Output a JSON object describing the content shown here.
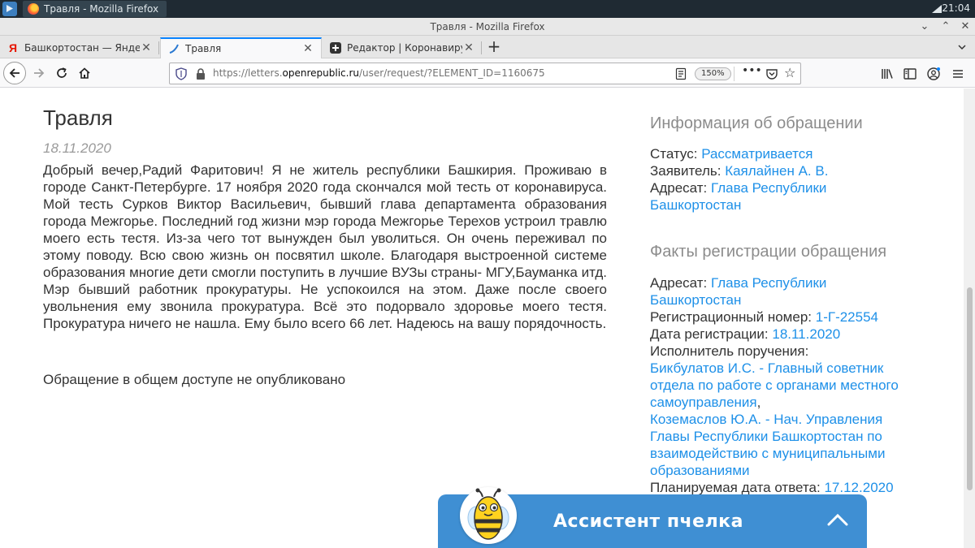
{
  "taskbar": {
    "task_label": "Травля - Mozilla Firefox",
    "clock": "21:04"
  },
  "window": {
    "title": "Травля - Mozilla Firefox"
  },
  "tabs": [
    {
      "label": "Башкортостан — Яндекс: на",
      "favicon": "yandex-icon"
    },
    {
      "label": "Травля",
      "favicon": "openrepublic-icon"
    },
    {
      "label": "Редактор | Коронавирус. Ча",
      "favicon": "editor-plus-icon"
    }
  ],
  "navbar": {
    "url_prefix": "https://letters.",
    "url_domain": "openrepublic.ru",
    "url_path": "/user/request/?ELEMENT_ID=1160675",
    "zoom": "150%"
  },
  "article": {
    "title": "Травля",
    "date": "18.11.2020",
    "body": "Добрый вечер,Радий Фаритович! Я не житель республики Башкирия. Проживаю в городе Санкт-Петербурге. 17 ноября 2020 года скончался мой тесть от коронавируса. Мой тесть Сурков Виктор Васильевич, бывший глава департамента образования города Межгорье. Последний год жизни мэр города Межгорье Терехов устроил травлю моего есть тестя. Из-за чего тот вынужден был уволиться. Он очень переживал по этому поводу. Всю свою жизнь он посвятил школе. Благодаря выстроенной системе образования многие дети смогли поступить в лучшие ВУЗы страны- МГУ,Бауманка итд. Мэр бывший работник прокуратуры. Не успокоился на этом. Даже после своего увольнения ему звонила прокуратура. Всё это подорвало здоровье моего тестя. Прокуратура ничего не нашла. Ему было всего 66 лет. Надеюсь на вашу порядочность.",
    "note": "Обращение в общем доступе не опубликовано"
  },
  "info": {
    "heading": "Информация об обращении",
    "status_label": "Статус:",
    "status_value": "Рассматривается",
    "applicant_label": "Заявитель:",
    "applicant_value": "Каялайнен А. В.",
    "addressee_label": "Адресат:",
    "addressee_value": "Глава Республики Башкортостан"
  },
  "registration": {
    "heading": "Факты регистрации обращения",
    "addressee_label": "Адресат:",
    "addressee_value": "Глава Республики Башкортостан",
    "reg_number_label": "Регистрационный номер:",
    "reg_number_value": "1-Г-22554",
    "reg_date_label": "Дата регистрации:",
    "reg_date_value": "18.11.2020",
    "executor_label": "Исполнитель поручения:",
    "executor_1": "Бикбулатов И.С. - Главный советник отдела по работе с органами местного самоуправления",
    "executor_sep": ",",
    "executor_2": "Коземаслов Ю.А. - Нач. Управления Главы Республики Башкортостан по взаимодействию с муниципальными образованиями",
    "planned_date_label": "Планируемая дата ответа:",
    "planned_date_value": "17.12.2020"
  },
  "assistant": {
    "label": "Ассистент пчелка"
  },
  "colors": {
    "link": "#1e90e8",
    "assistant_bg": "#3f8fd3",
    "active_tab_accent": "#0a84ff"
  }
}
